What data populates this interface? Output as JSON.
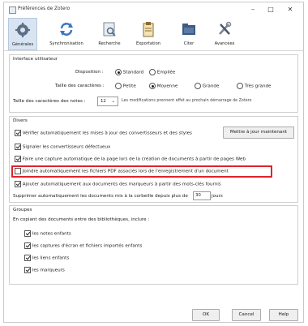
{
  "window": {
    "title": "Préférences de Zotero"
  },
  "window_controls": {
    "minimize": "–",
    "maximize": "□",
    "close": "✕"
  },
  "toolbar": [
    {
      "label": "Générales",
      "icon": "gear-icon"
    },
    {
      "label": "Synchronisation",
      "icon": "sync-icon"
    },
    {
      "label": "Recherche",
      "icon": "search-icon"
    },
    {
      "label": "Exportation",
      "icon": "clipboard-icon"
    },
    {
      "label": "Citer",
      "icon": "folder-icon"
    },
    {
      "label": "Avancées",
      "icon": "tools-icon"
    }
  ],
  "interface": {
    "title": "Interface utilisateur",
    "layout_label": "Disposition :",
    "layout_options": [
      "Standard",
      "Empilée"
    ],
    "fontsize_label": "Taille des caractères :",
    "fontsize_options": [
      "Petite",
      "Moyenne",
      "Grande",
      "Très grande"
    ],
    "notes_fontsize_label": "Taille des caractères des notes :",
    "notes_fontsize_value": "12",
    "notes_fontsize_hint": "Les modifications prennent effet au prochain démarrage de Zotero"
  },
  "divers": {
    "title": "Divers",
    "checks": [
      "Vérifier automatiquement les mises à jour des convertisseurs et des styles",
      "Signaler les convertisseurs défectueux",
      "Faire une capture automatique de la page lors de la création de documents à partir de pages Web",
      "Joindre automatiquement les fichiers PDF associés lors de l'enregistrement d'un document",
      "Ajouter automatiquement aux documents des marqueurs à partir des mots-clés fournis"
    ],
    "update_button": "Mettre à jour maintenant",
    "trash_label": "Supprimer automatiquement les documents mis à la corbeille depuis plus de",
    "trash_value": "30",
    "trash_unit": "jours"
  },
  "groups": {
    "title": "Groupes",
    "intro": "En copiant des documents entre des bibliothèques, inclure :",
    "checks": [
      "les notes enfants",
      "les captures d'écran et fichiers importés enfants",
      "les liens enfants",
      "les marqueurs"
    ]
  },
  "buttons": {
    "ok": "OK",
    "cancel": "Cancel",
    "help": "Help"
  },
  "colors": {
    "highlight": "#e0232b",
    "active_tab": "#d9e4f2"
  }
}
